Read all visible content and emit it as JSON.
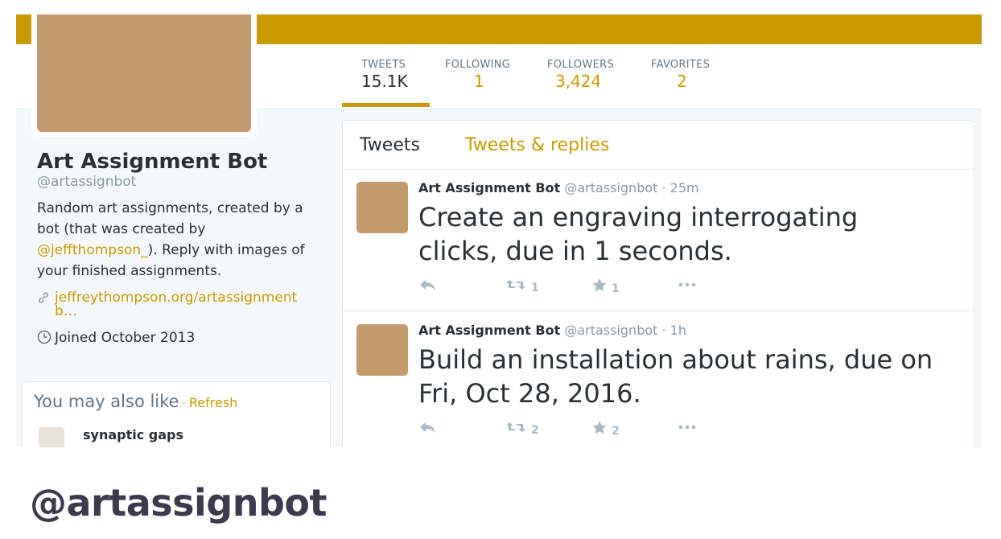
{
  "stats": [
    {
      "label": "TWEETS",
      "value": "15.1K"
    },
    {
      "label": "FOLLOWING",
      "value": "1"
    },
    {
      "label": "FOLLOWERS",
      "value": "3,424"
    },
    {
      "label": "FAVORITES",
      "value": "2"
    }
  ],
  "profile": {
    "name": "Art Assignment Bot",
    "handle": "@artassignbot",
    "bio_1": "Random art assignments, created by a bot (that was created by ",
    "bio_link": "@jeffthompson_",
    "bio_2": "). Reply with images of your finished assignments.",
    "url": "jeffreythompson.org/artassignmentb…",
    "joined": "Joined October 2013"
  },
  "who_to_follow": {
    "title": "You may also like",
    "separator": " · ",
    "refresh": "Refresh",
    "user_name": "synaptic gaps"
  },
  "timeline": {
    "tabs": [
      "Tweets",
      "Tweets & replies"
    ],
    "tweets": [
      {
        "name": "Art Assignment Bot",
        "handle": "@artassignbot",
        "time": "· 25m",
        "text": "Create an engraving interrogating clicks, due in 1 seconds.",
        "retweets": "1",
        "likes": "1"
      },
      {
        "name": "Art Assignment Bot",
        "handle": "@artassignbot",
        "time": "· 1h",
        "text": "Build an installation about rains, due on Fri, Oct 28, 2016.",
        "retweets": "2",
        "likes": "2"
      }
    ]
  },
  "icons": {
    "reply": "reply-icon",
    "retweet": "retweet-icon",
    "like": "star-icon",
    "more": "more-icon",
    "link": "link-icon",
    "calendar": "clock-icon"
  },
  "caption": "@artassignbot",
  "colors": {
    "accent": "#c99a00",
    "avatar": "#c4996c"
  }
}
